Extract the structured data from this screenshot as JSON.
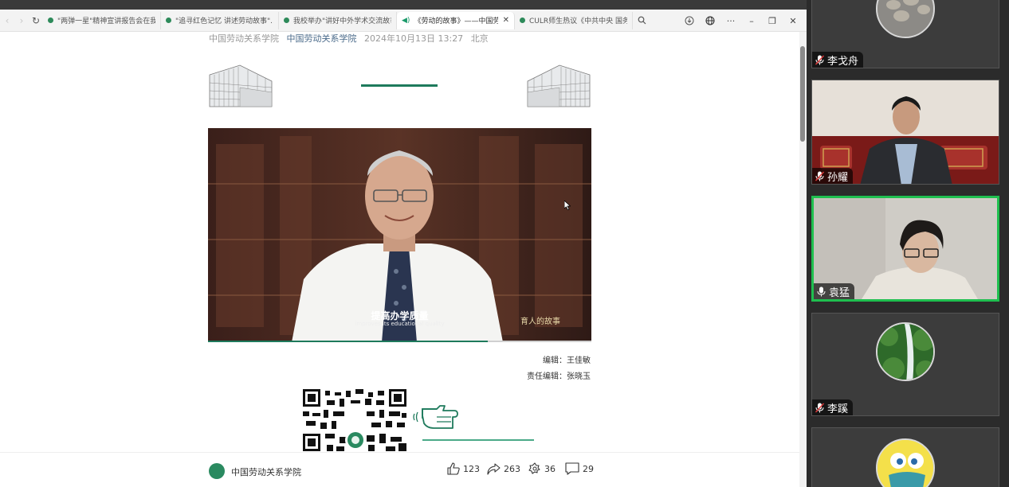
{
  "browser": {
    "tabs": [
      {
        "title": "\"两弹一星\"精神宣讲报告会在我"
      },
      {
        "title": "\"追寻红色记忆 讲述劳动故事\"..."
      },
      {
        "title": "我校举办\"讲好中外学术交流故事"
      },
      {
        "title": "《劳动的故事》——中国劳"
      },
      {
        "title": "CULR师生热议《中共中央 国务"
      }
    ],
    "nav_back": "‹",
    "nav_forward": "›",
    "reload_icon": "↻",
    "close_tab": "✕",
    "window_controls": {
      "menu": "···",
      "minimize": "–",
      "restore": "❐",
      "close": "✕"
    }
  },
  "article": {
    "meta_org": "中国劳动关系学院",
    "meta_source": "中国劳动关系学院",
    "meta_date": "2024年10月13日 13:27",
    "meta_location": "北京",
    "video_subtitle_cn": "提高办学质量",
    "video_subtitle_en": "improves its educational quality",
    "video_watermark": "育人的故事",
    "video_progress": 0.73,
    "editor": "编辑：王佳敏",
    "chief_editor": "责任编辑：张晓玉"
  },
  "footer": {
    "account": "中国劳动关系学院",
    "likes": "123",
    "shares": "263",
    "recommends": "36",
    "comments": "29"
  },
  "participants": [
    {
      "name": "李戈舟",
      "muted": true
    },
    {
      "name": "孙耀",
      "muted": true
    },
    {
      "name": "袁猛",
      "muted": false
    },
    {
      "name": "李蹊",
      "muted": true
    }
  ],
  "colors": {
    "accent": "#1e7a5c",
    "speaking": "#1fbf4f"
  }
}
